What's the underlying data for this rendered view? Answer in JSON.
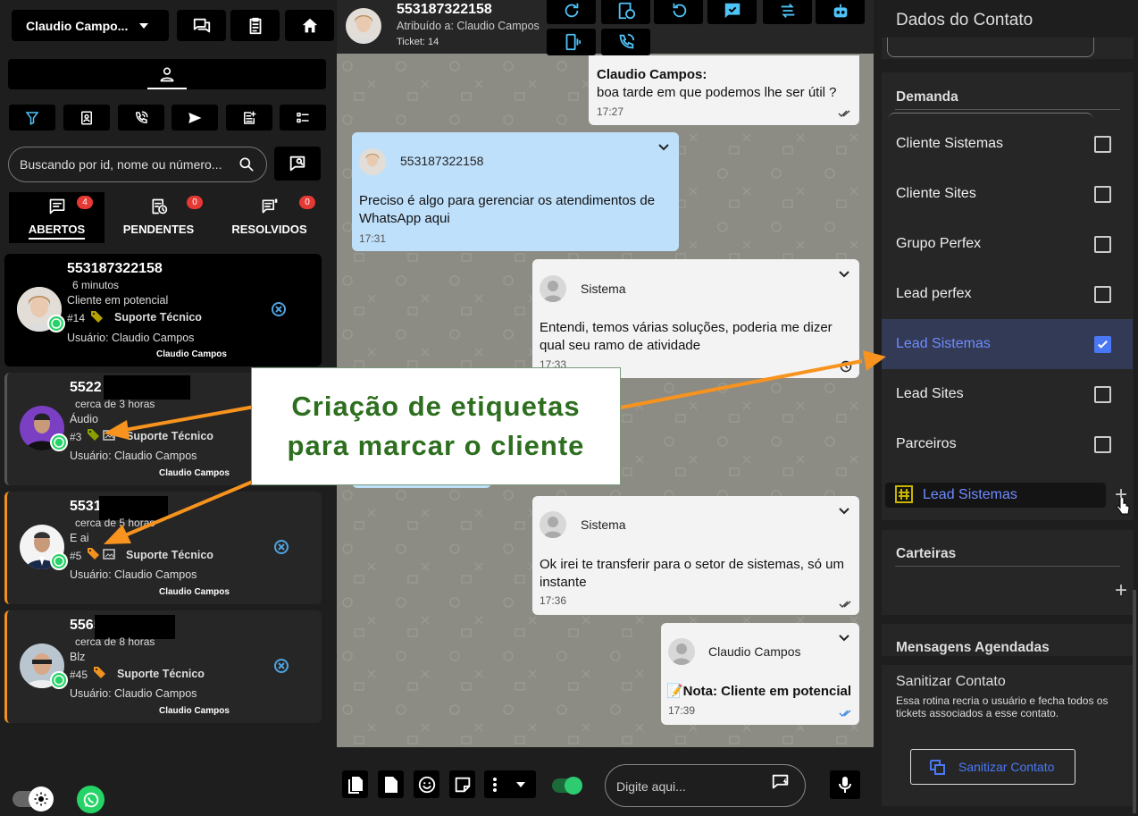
{
  "left": {
    "user_menu": "Claudio Campo...",
    "search_placeholder": "Buscando por id, nome ou número...",
    "tabs": [
      {
        "label": "ABERTOS",
        "count": "4"
      },
      {
        "label": "PENDENTES",
        "count": "0"
      },
      {
        "label": "RESOLVIDOS",
        "count": "0"
      }
    ],
    "tickets": [
      {
        "number": "553187322158",
        "time": "6 minutos",
        "last": "Cliente em potencial",
        "id": "#14",
        "queue": "Suporte Técnico",
        "user": "Usuário: Claudio Campos",
        "user_tag": "Claudio Campos",
        "tag_color": "#b5a300"
      },
      {
        "number": "5522",
        "time": "cerca de 3 horas",
        "last": "Áudio",
        "id": "#3",
        "queue": "Suporte Técnico",
        "user": "Usuário: Claudio Campos",
        "user_tag": "Claudio Campos",
        "tag_color": "#8aa000"
      },
      {
        "number": "5531",
        "time": "cerca de 5 horas",
        "last": "E ai",
        "id": "#5",
        "queue": "Suporte Técnico",
        "user": "Usuário: Claudio Campos",
        "user_tag": "Claudio Campos",
        "tag_color": "#f09220"
      },
      {
        "number": "5565",
        "time": "cerca de 8 horas",
        "last": "Blz",
        "id": "#45",
        "queue": "Suporte Técnico",
        "user": "Usuário: Claudio Campos",
        "user_tag": "Claudio Campos",
        "tag_color": "#f09220"
      }
    ]
  },
  "chat": {
    "contact_number": "553187322158",
    "assigned": "Atribuído a: Claudio Campos",
    "ticket": "Ticket: 14",
    "messages": [
      {
        "sender": "Claudio Campos:",
        "text": "boa tarde em que podemos lhe ser útil ?",
        "time": "17:27"
      },
      {
        "sender": "553187322158",
        "text": "Preciso é algo para gerenciar os atendimentos de WhatsApp aqui",
        "time": "17:31"
      },
      {
        "sender": "Sistema",
        "text": "Entendi, temos várias soluções, poderia me dizer qual seu ramo de atividade",
        "time": "17:33"
      },
      {
        "sender": "Sistema",
        "text": "Ok irei te transferir para o setor de sistemas, só um instante",
        "time": "17:36"
      },
      {
        "sender": "Claudio Campos",
        "text": "📝Nota: Cliente em potencial",
        "time": "17:39"
      }
    ],
    "input_placeholder": "Digite aqui..."
  },
  "right": {
    "title": "Dados do Contato",
    "demanda_label": "Demanda",
    "options": [
      {
        "label": "Cliente Sistemas",
        "checked": false
      },
      {
        "label": "Cliente Sites",
        "checked": false
      },
      {
        "label": "Grupo Perfex",
        "checked": false
      },
      {
        "label": "Lead perfex",
        "checked": false
      },
      {
        "label": "Lead Sistemas",
        "checked": true
      },
      {
        "label": "Lead Sites",
        "checked": false
      },
      {
        "label": "Parceiros",
        "checked": false
      }
    ],
    "selected_tag": "Lead Sistemas",
    "carteiras_label": "Carteiras",
    "agendadas_label": "Mensagens Agendadas",
    "sanitize_title": "Sanitizar Contato",
    "sanitize_desc": "Essa rotina recria o usuário e fecha todos os tickets associados a esse contato.",
    "sanitize_button": "Sanitizar Contato"
  },
  "callout": {
    "line1": "Criação de etiquetas",
    "line2": "para marcar o cliente"
  },
  "colors": {
    "accent": "#4a78f5",
    "annotation": "#f7931e",
    "callout_text": "#2d6e1f",
    "whatsapp": "#25d366",
    "bubble_in": "#bfe0fb",
    "bubble_out": "#f3f3f3"
  }
}
